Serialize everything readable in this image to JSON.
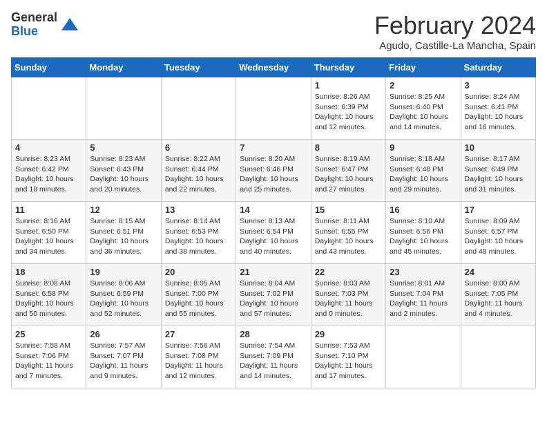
{
  "header": {
    "logo_general": "General",
    "logo_blue": "Blue",
    "title": "February 2024",
    "location": "Agudo, Castille-La Mancha, Spain"
  },
  "days_of_week": [
    "Sunday",
    "Monday",
    "Tuesday",
    "Wednesday",
    "Thursday",
    "Friday",
    "Saturday"
  ],
  "weeks": [
    [
      {
        "day": "",
        "content": ""
      },
      {
        "day": "",
        "content": ""
      },
      {
        "day": "",
        "content": ""
      },
      {
        "day": "",
        "content": ""
      },
      {
        "day": "1",
        "content": "Sunrise: 8:26 AM\nSunset: 6:39 PM\nDaylight: 10 hours\nand 12 minutes."
      },
      {
        "day": "2",
        "content": "Sunrise: 8:25 AM\nSunset: 6:40 PM\nDaylight: 10 hours\nand 14 minutes."
      },
      {
        "day": "3",
        "content": "Sunrise: 8:24 AM\nSunset: 6:41 PM\nDaylight: 10 hours\nand 16 minutes."
      }
    ],
    [
      {
        "day": "4",
        "content": "Sunrise: 8:23 AM\nSunset: 6:42 PM\nDaylight: 10 hours\nand 18 minutes."
      },
      {
        "day": "5",
        "content": "Sunrise: 8:23 AM\nSunset: 6:43 PM\nDaylight: 10 hours\nand 20 minutes."
      },
      {
        "day": "6",
        "content": "Sunrise: 8:22 AM\nSunset: 6:44 PM\nDaylight: 10 hours\nand 22 minutes."
      },
      {
        "day": "7",
        "content": "Sunrise: 8:20 AM\nSunset: 6:46 PM\nDaylight: 10 hours\nand 25 minutes."
      },
      {
        "day": "8",
        "content": "Sunrise: 8:19 AM\nSunset: 6:47 PM\nDaylight: 10 hours\nand 27 minutes."
      },
      {
        "day": "9",
        "content": "Sunrise: 8:18 AM\nSunset: 6:48 PM\nDaylight: 10 hours\nand 29 minutes."
      },
      {
        "day": "10",
        "content": "Sunrise: 8:17 AM\nSunset: 6:49 PM\nDaylight: 10 hours\nand 31 minutes."
      }
    ],
    [
      {
        "day": "11",
        "content": "Sunrise: 8:16 AM\nSunset: 6:50 PM\nDaylight: 10 hours\nand 34 minutes."
      },
      {
        "day": "12",
        "content": "Sunrise: 8:15 AM\nSunset: 6:51 PM\nDaylight: 10 hours\nand 36 minutes."
      },
      {
        "day": "13",
        "content": "Sunrise: 8:14 AM\nSunset: 6:53 PM\nDaylight: 10 hours\nand 38 minutes."
      },
      {
        "day": "14",
        "content": "Sunrise: 8:13 AM\nSunset: 6:54 PM\nDaylight: 10 hours\nand 40 minutes."
      },
      {
        "day": "15",
        "content": "Sunrise: 8:11 AM\nSunset: 6:55 PM\nDaylight: 10 hours\nand 43 minutes."
      },
      {
        "day": "16",
        "content": "Sunrise: 8:10 AM\nSunset: 6:56 PM\nDaylight: 10 hours\nand 45 minutes."
      },
      {
        "day": "17",
        "content": "Sunrise: 8:09 AM\nSunset: 6:57 PM\nDaylight: 10 hours\nand 48 minutes."
      }
    ],
    [
      {
        "day": "18",
        "content": "Sunrise: 8:08 AM\nSunset: 6:58 PM\nDaylight: 10 hours\nand 50 minutes."
      },
      {
        "day": "19",
        "content": "Sunrise: 8:06 AM\nSunset: 6:59 PM\nDaylight: 10 hours\nand 52 minutes."
      },
      {
        "day": "20",
        "content": "Sunrise: 8:05 AM\nSunset: 7:00 PM\nDaylight: 10 hours\nand 55 minutes."
      },
      {
        "day": "21",
        "content": "Sunrise: 8:04 AM\nSunset: 7:02 PM\nDaylight: 10 hours\nand 57 minutes."
      },
      {
        "day": "22",
        "content": "Sunrise: 8:03 AM\nSunset: 7:03 PM\nDaylight: 11 hours\nand 0 minutes."
      },
      {
        "day": "23",
        "content": "Sunrise: 8:01 AM\nSunset: 7:04 PM\nDaylight: 11 hours\nand 2 minutes."
      },
      {
        "day": "24",
        "content": "Sunrise: 8:00 AM\nSunset: 7:05 PM\nDaylight: 11 hours\nand 4 minutes."
      }
    ],
    [
      {
        "day": "25",
        "content": "Sunrise: 7:58 AM\nSunset: 7:06 PM\nDaylight: 11 hours\nand 7 minutes."
      },
      {
        "day": "26",
        "content": "Sunrise: 7:57 AM\nSunset: 7:07 PM\nDaylight: 11 hours\nand 9 minutes."
      },
      {
        "day": "27",
        "content": "Sunrise: 7:56 AM\nSunset: 7:08 PM\nDaylight: 11 hours\nand 12 minutes."
      },
      {
        "day": "28",
        "content": "Sunrise: 7:54 AM\nSunset: 7:09 PM\nDaylight: 11 hours\nand 14 minutes."
      },
      {
        "day": "29",
        "content": "Sunrise: 7:53 AM\nSunset: 7:10 PM\nDaylight: 11 hours\nand 17 minutes."
      },
      {
        "day": "",
        "content": ""
      },
      {
        "day": "",
        "content": ""
      }
    ]
  ]
}
